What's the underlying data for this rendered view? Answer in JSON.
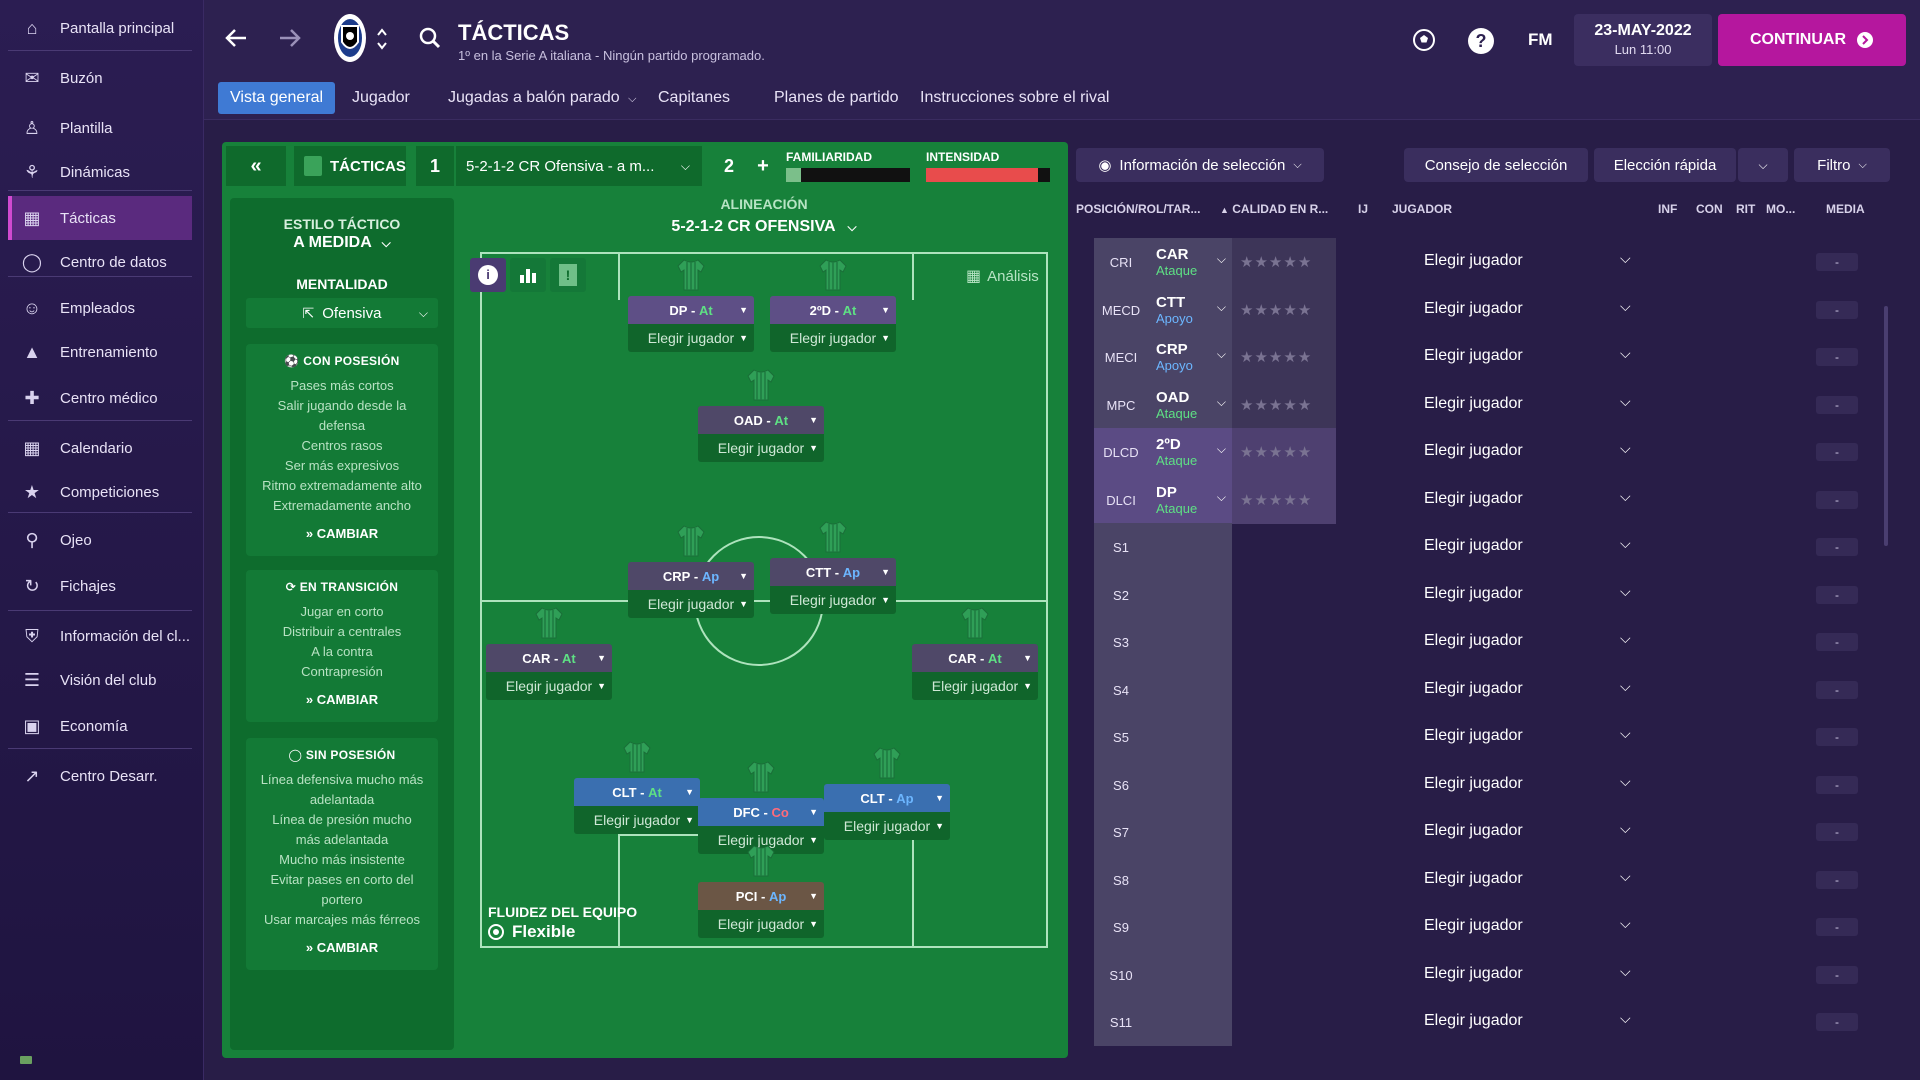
{
  "sidebar": {
    "items": [
      {
        "label": "Pantalla principal",
        "icon": "home-icon"
      },
      {
        "label": "Buzón",
        "icon": "inbox-icon"
      },
      {
        "label": "Plantilla",
        "icon": "squad-icon"
      },
      {
        "label": "Dinámicas",
        "icon": "dynamics-icon"
      },
      {
        "label": "Tácticas",
        "icon": "tactics-icon"
      },
      {
        "label": "Centro de datos",
        "icon": "data-icon"
      },
      {
        "label": "Empleados",
        "icon": "staff-icon"
      },
      {
        "label": "Entrenamiento",
        "icon": "training-icon"
      },
      {
        "label": "Centro médico",
        "icon": "medical-icon"
      },
      {
        "label": "Calendario",
        "icon": "calendar-icon"
      },
      {
        "label": "Competiciones",
        "icon": "trophy-icon"
      },
      {
        "label": "Ojeo",
        "icon": "scouting-icon"
      },
      {
        "label": "Fichajes",
        "icon": "transfers-icon"
      },
      {
        "label": "Información del cl...",
        "icon": "club-info-icon"
      },
      {
        "label": "Visión del club",
        "icon": "club-vision-icon"
      },
      {
        "label": "Economía",
        "icon": "finance-icon"
      },
      {
        "label": "Centro Desarr.",
        "icon": "development-icon"
      }
    ]
  },
  "header": {
    "title": "TÁCTICAS",
    "subtitle": "1º en la Serie A italiana - Ningún partido programado.",
    "date": "23-MAY-2022",
    "time": "Lun 11:00",
    "fm_label": "FM",
    "continue_label": "CONTINUAR"
  },
  "nav": {
    "tabs": [
      "Vista general",
      "Jugador",
      "Jugadas a balón parado",
      "Capitanes",
      "Planes de partido",
      "Instrucciones sobre el rival"
    ]
  },
  "tactics_bar": {
    "label": "TÁCTICAS",
    "slot1": "1",
    "tactic_name": "5-2-1-2 CR Ofensiva - a m...",
    "slot2": "2",
    "plus": "+",
    "familiaridad": "FAMILIARIDAD",
    "intensidad": "INTENSIDAD",
    "familiaridad_level": 0.12,
    "intensidad_level": 0.9
  },
  "style": {
    "estilo_label": "ESTILO TÁCTICO",
    "estilo_value": "A MEDIDA",
    "mentalidad_label": "MENTALIDAD",
    "mentalidad_value": "Ofensiva",
    "change_label": "CAMBIAR",
    "con_posesion": {
      "title": "CON POSESIÓN",
      "lines": [
        "Pases más cortos",
        "Salir jugando desde la",
        "defensa",
        "Centros rasos",
        "Ser más expresivos",
        "Ritmo extremadamente alto",
        "Extremadamente ancho"
      ]
    },
    "en_transicion": {
      "title": "EN TRANSICIÓN",
      "lines": [
        "Jugar en corto",
        "Distribuir a centrales",
        "A la contra",
        "Contrapresión"
      ]
    },
    "sin_posesion": {
      "title": "SIN POSESIÓN",
      "lines": [
        "Línea defensiva mucho más",
        "adelantada",
        "Línea de presión mucho",
        "más adelantada",
        "Mucho más insistente",
        "Evitar pases en corto del",
        "portero",
        "Usar marcajes más férreos"
      ]
    }
  },
  "pitch": {
    "alineacion_label": "ALINEACIÓN",
    "formation": "5-2-1-2 CR OFENSIVA",
    "analisis_label": "Análisis",
    "fluidez_label": "FLUIDEZ DEL EQUIPO",
    "fluidez_value": "Flexible",
    "pick_label": "Elegir jugador",
    "players": [
      {
        "role": "DP",
        "duty": "At"
      },
      {
        "role": "2ºD",
        "duty": "At"
      },
      {
        "role": "OAD",
        "duty": "At"
      },
      {
        "role": "CRP",
        "duty": "Ap"
      },
      {
        "role": "CTT",
        "duty": "Ap"
      },
      {
        "role": "CAR",
        "duty": "At"
      },
      {
        "role": "CAR",
        "duty": "At"
      },
      {
        "role": "CLT",
        "duty": "At"
      },
      {
        "role": "DFC",
        "duty": "Co"
      },
      {
        "role": "CLT",
        "duty": "Ap"
      },
      {
        "role": "PCI",
        "duty": "Ap"
      }
    ]
  },
  "right_panel": {
    "info_seleccion": "Información de selección",
    "consejo": "Consejo de selección",
    "eleccion_rapida": "Elección rápida",
    "filtro": "Filtro",
    "columns": {
      "posicion": "POSICIÓN/ROL/TAR...",
      "calidad": "CALIDAD EN R...",
      "ij": "IJ",
      "jugador": "JUGADOR",
      "inf": "INF",
      "con": "CON",
      "rit": "RIT",
      "mo": "MO...",
      "media": "MEDIA"
    },
    "elegir_label": "Elegir jugador",
    "media_value": "-",
    "rows": [
      {
        "pos": "CRI",
        "role": "CAR",
        "duty": "Ataque"
      },
      {
        "pos": "MECD",
        "role": "CTT",
        "duty": "Apoyo"
      },
      {
        "pos": "MECI",
        "role": "CRP",
        "duty": "Apoyo"
      },
      {
        "pos": "MPC",
        "role": "OAD",
        "duty": "Ataque"
      },
      {
        "pos": "DLCD",
        "role": "2ºD",
        "duty": "Ataque"
      },
      {
        "pos": "DLCI",
        "role": "DP",
        "duty": "Ataque"
      },
      {
        "pos": "S1"
      },
      {
        "pos": "S2"
      },
      {
        "pos": "S3"
      },
      {
        "pos": "S4"
      },
      {
        "pos": "S5"
      },
      {
        "pos": "S6"
      },
      {
        "pos": "S7"
      },
      {
        "pos": "S8"
      },
      {
        "pos": "S9"
      },
      {
        "pos": "S10"
      },
      {
        "pos": "S11"
      }
    ]
  },
  "colors": {
    "accent_magenta": "#b5179e",
    "nav_active": "#3f7ad4",
    "pitch_green": "#17813a",
    "duty_attack": "#5ee084",
    "duty_support": "#6cb6ff",
    "duty_cover": "#ff6b7a"
  }
}
